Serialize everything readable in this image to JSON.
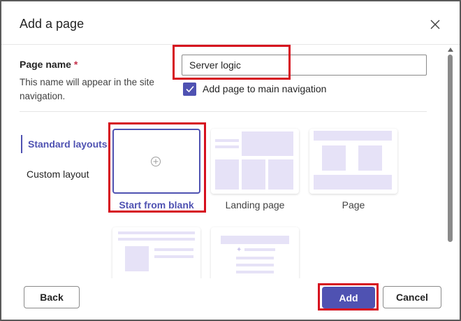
{
  "dialog": {
    "title": "Add a page",
    "close_icon": "close-icon"
  },
  "page_name": {
    "label": "Page name",
    "required_marker": "*",
    "description": "This name will appear in the site navigation.",
    "value": "Server logic"
  },
  "nav_checkbox": {
    "label": "Add page to main navigation",
    "checked": true
  },
  "layout_nav": {
    "standard": "Standard layouts",
    "custom": "Custom layout",
    "selected": "Standard layouts"
  },
  "layouts": [
    {
      "label": "Start from blank",
      "selected": true,
      "icon": "plus-circle-icon"
    },
    {
      "label": "Landing page",
      "selected": false
    },
    {
      "label": "Page",
      "selected": false
    }
  ],
  "footer": {
    "back": "Back",
    "add": "Add",
    "cancel": "Cancel"
  },
  "colors": {
    "accent": "#4f52b2",
    "highlight": "#d6101e",
    "placeholder_block": "#e6e2f7"
  }
}
